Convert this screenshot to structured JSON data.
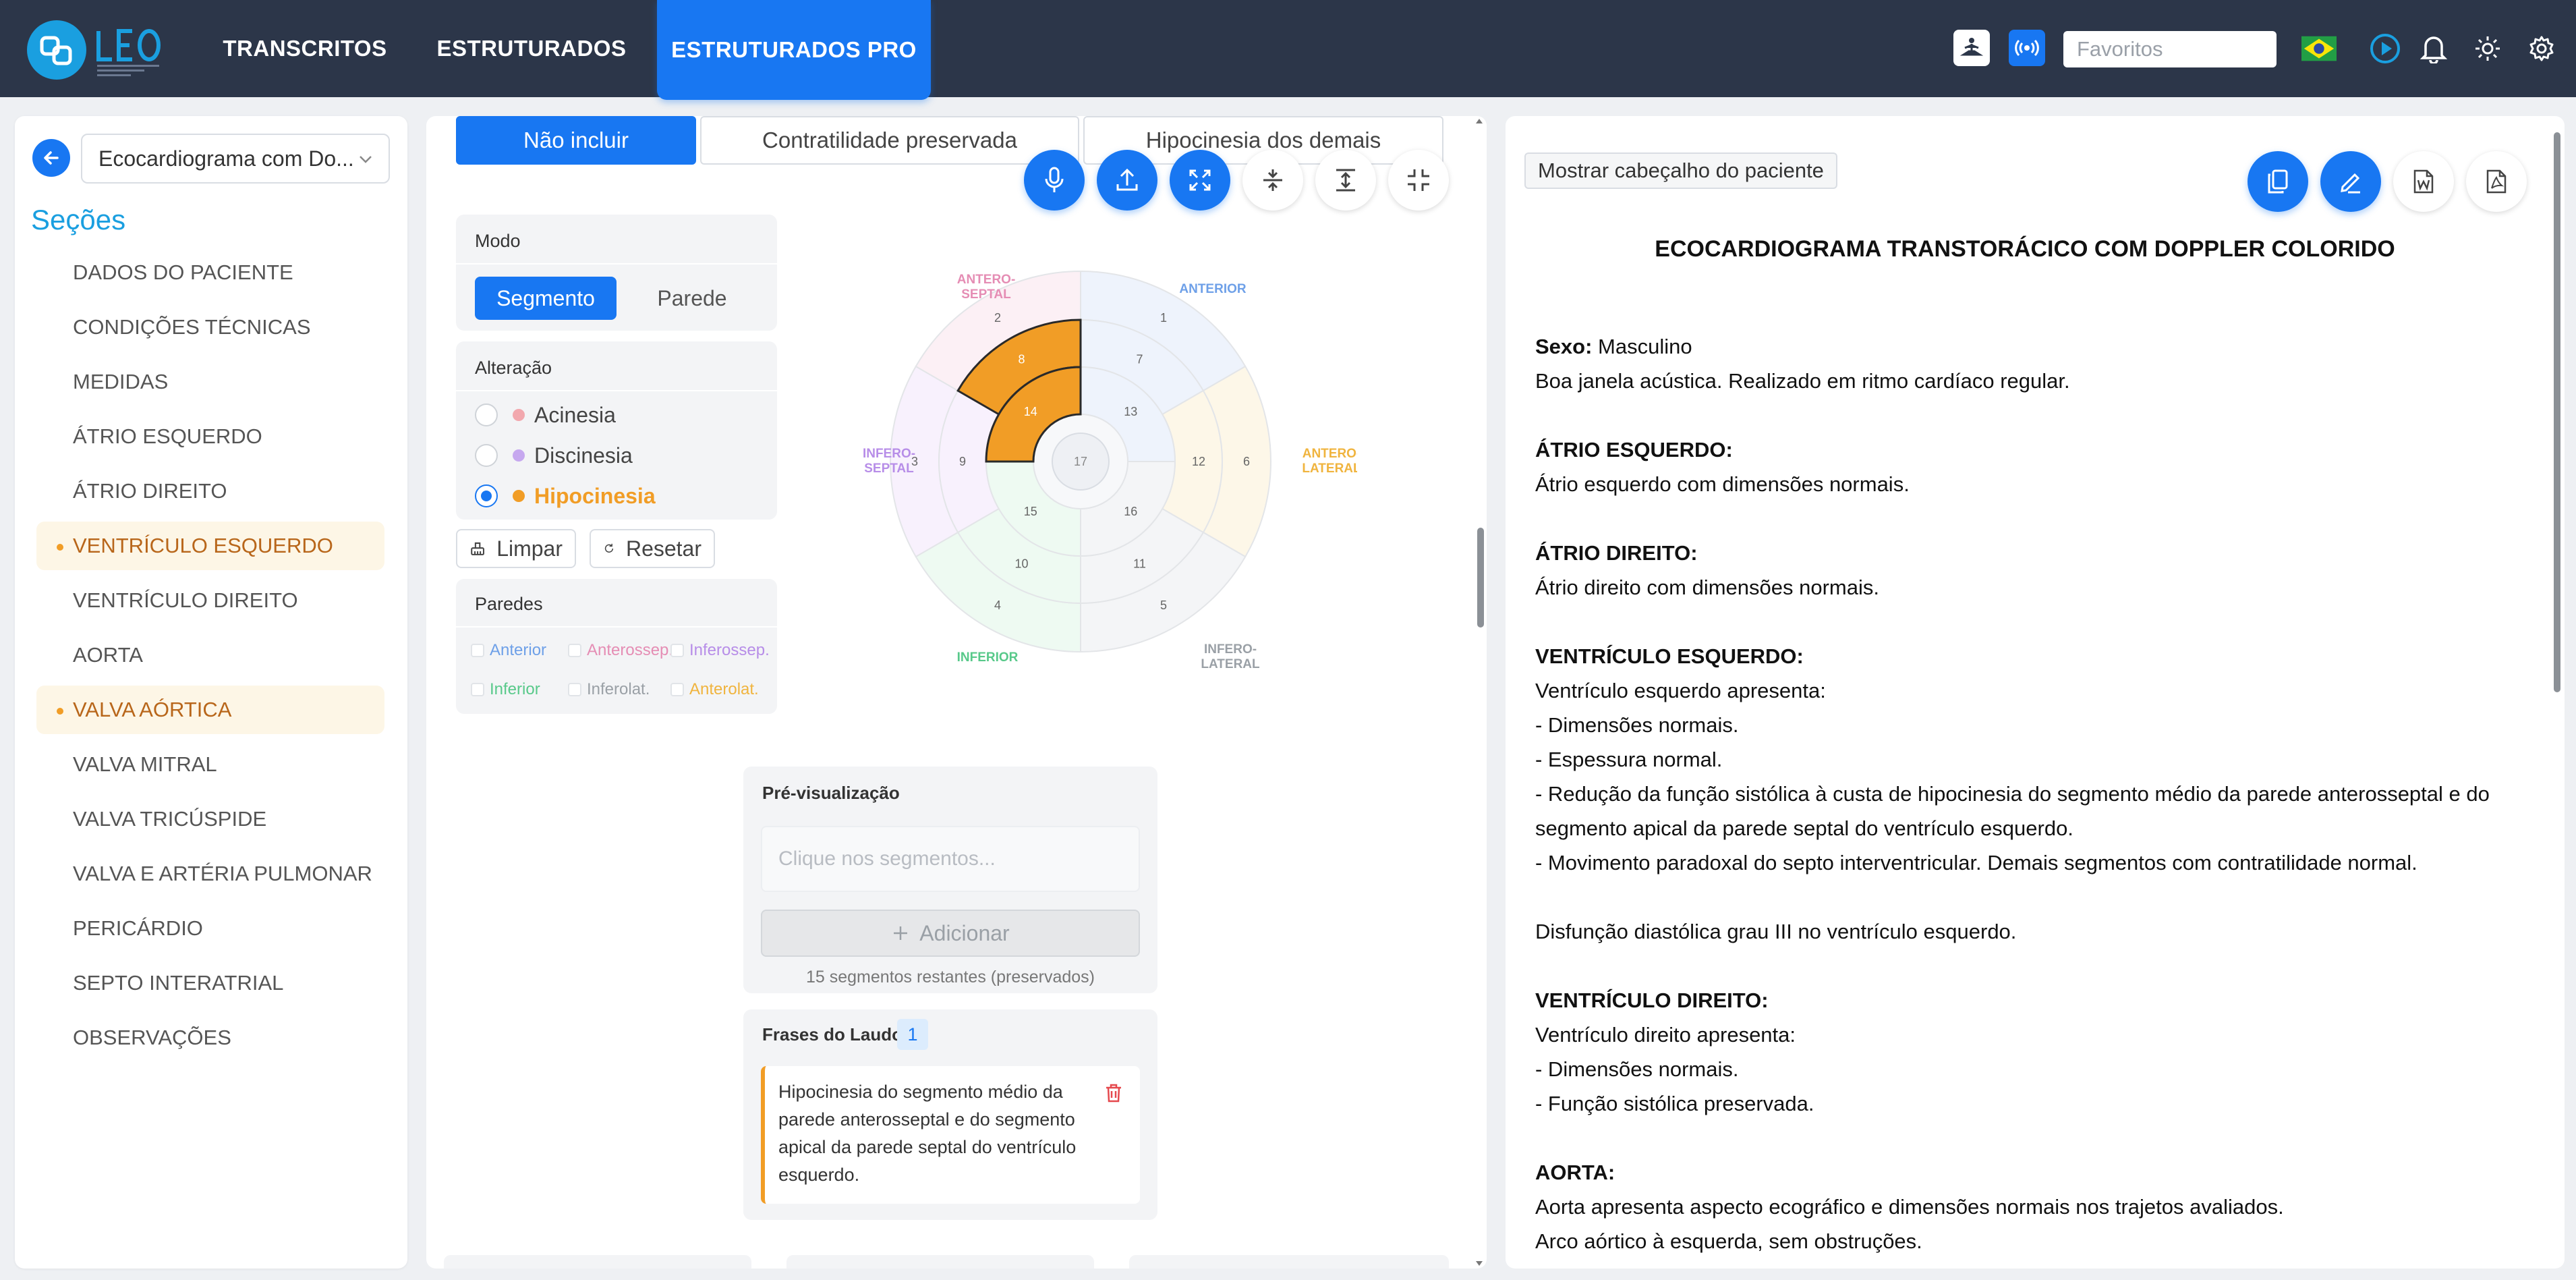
{
  "nav": {
    "items": [
      {
        "label": "TRANSCRITOS"
      },
      {
        "label": "ESTRUTURADOS"
      },
      {
        "label": "ESTRUTURADOS PRO"
      }
    ],
    "favorites_placeholder": "Favoritos"
  },
  "sidebar": {
    "template_select": "Ecocardiograma com Do...",
    "sections_title": "Seções",
    "sections": [
      {
        "label": "DADOS DO PACIENTE"
      },
      {
        "label": "CONDIÇÕES TÉCNICAS"
      },
      {
        "label": "MEDIDAS"
      },
      {
        "label": "ÁTRIO ESQUERDO"
      },
      {
        "label": "ÁTRIO DIREITO"
      },
      {
        "label": "VENTRÍCULO ESQUERDO",
        "highlighted": true
      },
      {
        "label": "VENTRÍCULO DIREITO"
      },
      {
        "label": "AORTA"
      },
      {
        "label": "VALVA AÓRTICA",
        "highlighted": true
      },
      {
        "label": "VALVA MITRAL"
      },
      {
        "label": "VALVA TRICÚSPIDE"
      },
      {
        "label": "VALVA E ARTÉRIA PULMONAR"
      },
      {
        "label": "PERICÁRDIO"
      },
      {
        "label": "SEPTO INTERATRIAL"
      },
      {
        "label": "OBSERVAÇÕES"
      }
    ]
  },
  "editor": {
    "tabs": [
      {
        "label": "Não incluir",
        "active": true
      },
      {
        "label": "Contratilidade preservada"
      },
      {
        "label": "Hipocinesia dos demais"
      }
    ],
    "mode": {
      "title": "Modo",
      "segment_label": "Segmento",
      "wall_label": "Parede"
    },
    "alteration": {
      "title": "Alteração",
      "options": [
        {
          "label": "Acinesia",
          "color": "#f2a8ae"
        },
        {
          "label": "Discinesia",
          "color": "#c6a8ef"
        },
        {
          "label": "Hipocinesia",
          "color": "#f19d26",
          "selected": true
        }
      ]
    },
    "clear_label": "Limpar",
    "reset_label": "Resetar",
    "walls": {
      "title": "Paredes",
      "items": [
        {
          "label": "Anterior",
          "color": "#6ea0e8"
        },
        {
          "label": "Anterossep.",
          "color": "#e58db4"
        },
        {
          "label": "Inferossep.",
          "color": "#b78de8"
        },
        {
          "label": "Inferior",
          "color": "#58c98a"
        },
        {
          "label": "Inferolat.",
          "color": "#9aa0a6"
        },
        {
          "label": "Anterolat.",
          "color": "#f0b43e"
        }
      ]
    },
    "bullseye": {
      "labels": {
        "antero_septal": [
          "ANTERO-",
          "SEPTAL"
        ],
        "anterior": "ANTERIOR",
        "antero_lateral": [
          "ANTERO-",
          "LATERAL"
        ],
        "infero_septal": [
          "INFERO-",
          "SEPTAL"
        ],
        "inferior": "INFERIOR",
        "infero_lateral": [
          "INFERO-",
          "LATERAL"
        ]
      },
      "segments": [
        "1",
        "2",
        "3",
        "4",
        "5",
        "6",
        "7",
        "8",
        "9",
        "10",
        "11",
        "12",
        "13",
        "14",
        "15",
        "16",
        "17"
      ],
      "selected_segments": [
        "8",
        "14"
      ],
      "selected_color": "#f19d26"
    },
    "preview": {
      "title": "Pré-visualização",
      "placeholder": "Clique nos segmentos...",
      "add_label": "Adicionar",
      "remaining": "15 segmentos restantes (preservados)"
    },
    "phrases": {
      "title": "Frases do Laudo",
      "count": "1",
      "items": [
        "Hipocinesia do segmento médio da parede anterosseptal e do segmento apical da parede septal do ventrículo esquerdo."
      ]
    }
  },
  "report": {
    "header_toggle": "Mostrar cabeçalho do paciente",
    "title": "ECOCARDIOGRAMA TRANSTORÁCICO COM DOPPLER COLORIDO",
    "lines": [
      {
        "bold": "Sexo:",
        "text": " Masculino"
      },
      {
        "text": "Boa janela acústica. Realizado em ritmo cardíaco regular."
      },
      {
        "gap": true
      },
      {
        "bold": "ÁTRIO ESQUERDO:"
      },
      {
        "text": "Átrio esquerdo com dimensões normais."
      },
      {
        "gap": true
      },
      {
        "bold": "ÁTRIO DIREITO:"
      },
      {
        "text": "Átrio direito com dimensões normais."
      },
      {
        "gap": true
      },
      {
        "bold": "VENTRÍCULO ESQUERDO:"
      },
      {
        "text": "Ventrículo esquerdo apresenta:"
      },
      {
        "text": "- Dimensões normais."
      },
      {
        "text": "- Espessura normal."
      },
      {
        "text": "- Redução da função sistólica à custa de hipocinesia do segmento médio da parede anterosseptal e do"
      },
      {
        "text": "segmento apical da parede septal do ventrículo esquerdo."
      },
      {
        "text": "- Movimento paradoxal do septo interventricular. Demais segmentos com contratilidade normal."
      },
      {
        "gap": true
      },
      {
        "text": "Disfunção diastólica grau III no ventrículo esquerdo."
      },
      {
        "gap": true
      },
      {
        "bold": "VENTRÍCULO DIREITO:"
      },
      {
        "text": "Ventrículo direito apresenta:"
      },
      {
        "text": "- Dimensões normais."
      },
      {
        "text": "- Função sistólica preservada."
      },
      {
        "gap": true
      },
      {
        "bold": "AORTA:"
      },
      {
        "text": "Aorta apresenta aspecto ecográfico e dimensões normais nos trajetos avaliados."
      },
      {
        "text": "Arco aórtico à esquerda, sem obstruções."
      }
    ]
  },
  "colors": {
    "nav_bg": "#2c3649",
    "accent": "#1877f2",
    "section_title": "#1a9fe0",
    "highlight_bg": "#fdf6e6",
    "highlight_text": "#b8661a"
  }
}
